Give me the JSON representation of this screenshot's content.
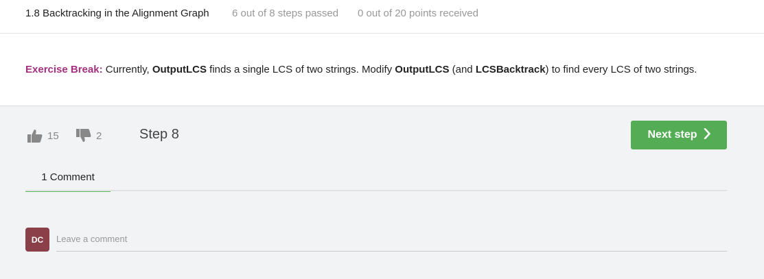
{
  "header": {
    "lesson_title": "1.8 Backtracking in the Alignment Graph",
    "steps_passed": "6 out of 8 steps passed",
    "points": "0 out of 20 points  received"
  },
  "exercise": {
    "label": "Exercise Break:",
    "text_1": " Currently, ",
    "bold_1": "OutputLCS",
    "text_2": " finds a single LCS of two strings. Modify ",
    "bold_2": "OutputLCS",
    "text_3": " (and ",
    "bold_3": "LCSBacktrack",
    "text_4": ") to find every LCS of two strings."
  },
  "footer": {
    "likes": "15",
    "dislikes": "2",
    "step_label": "Step 8",
    "next_label": "Next step",
    "comments_tab": "1  Comment",
    "avatar_initials": "DC",
    "comment_placeholder": "Leave a comment"
  },
  "colors": {
    "accent_green": "#54ad54",
    "exercise_label": "#a3307e",
    "avatar_bg": "#8b4049"
  },
  "icons": [
    "thumbs-up-icon",
    "thumbs-down-icon",
    "chevron-right-icon"
  ]
}
